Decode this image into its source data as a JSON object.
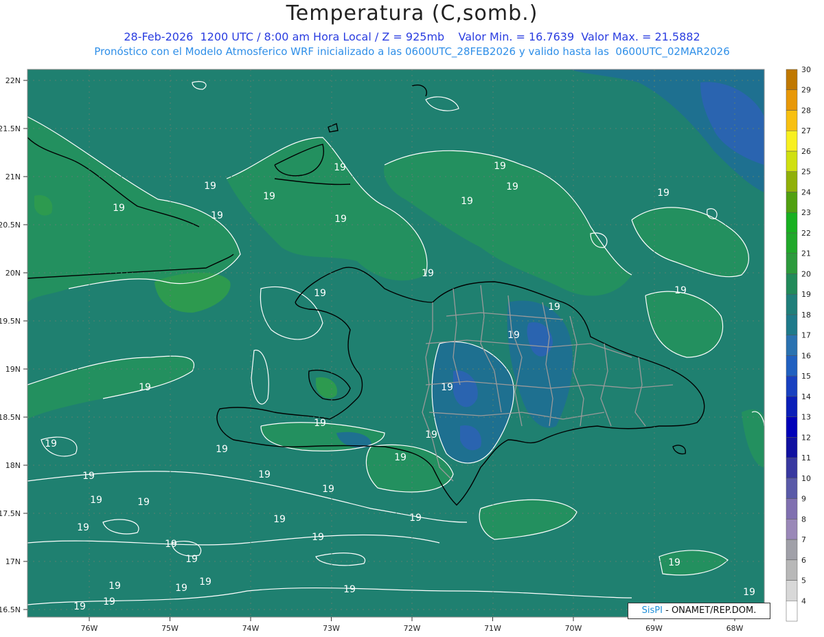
{
  "header": {
    "title": "Temperatura (C,somb.)",
    "subtitle_1": "28-Feb-2026  1200 UTC / 8:00 am Hora Local / Z = 925mb    Valor Min. = 16.7639  Valor Max. = 21.5882",
    "subtitle_2": "Pronóstico con el Modelo Atmosferico WRF inicializado a las 0600UTC_28FEB2026 y valido hasta las  0600UTC_02MAR2026"
  },
  "axes": {
    "lat_labels": [
      "22N",
      "21.5N",
      "21N",
      "20.5N",
      "20N",
      "19.5N",
      "19N",
      "18.5N",
      "18N",
      "17.5N",
      "17N",
      "16.5N"
    ],
    "lon_labels": [
      "76W",
      "75W",
      "74W",
      "73W",
      "72W",
      "71W",
      "70W",
      "69W",
      "68W"
    ]
  },
  "colorbar": {
    "levels": [
      "4",
      "5",
      "6",
      "7",
      "8",
      "9",
      "10",
      "11",
      "12",
      "13",
      "14",
      "15",
      "16",
      "17",
      "18",
      "19",
      "20",
      "21",
      "22",
      "23",
      "24",
      "25",
      "26",
      "27",
      "28",
      "29",
      "30"
    ],
    "colors": [
      "#ffffff",
      "#d8d8d8",
      "#b8b8b8",
      "#a0a0a8",
      "#9a88b8",
      "#8070b0",
      "#5a5aa8",
      "#3838a0",
      "#1010a0",
      "#0000b8",
      "#0a1eb8",
      "#1840c0",
      "#2060c0",
      "#2a72b0",
      "#1e7a8a",
      "#1f7f7a",
      "#218a5a",
      "#2c9a3c",
      "#20a82a",
      "#18b020",
      "#50a010",
      "#90b008",
      "#d0e010",
      "#f8f020",
      "#f8c010",
      "#e89808",
      "#c07800"
    ]
  },
  "contour_labels": [
    "19"
  ],
  "credit": {
    "brand": "SisPI",
    "text": " - ONAMET/REP.DOM."
  }
}
